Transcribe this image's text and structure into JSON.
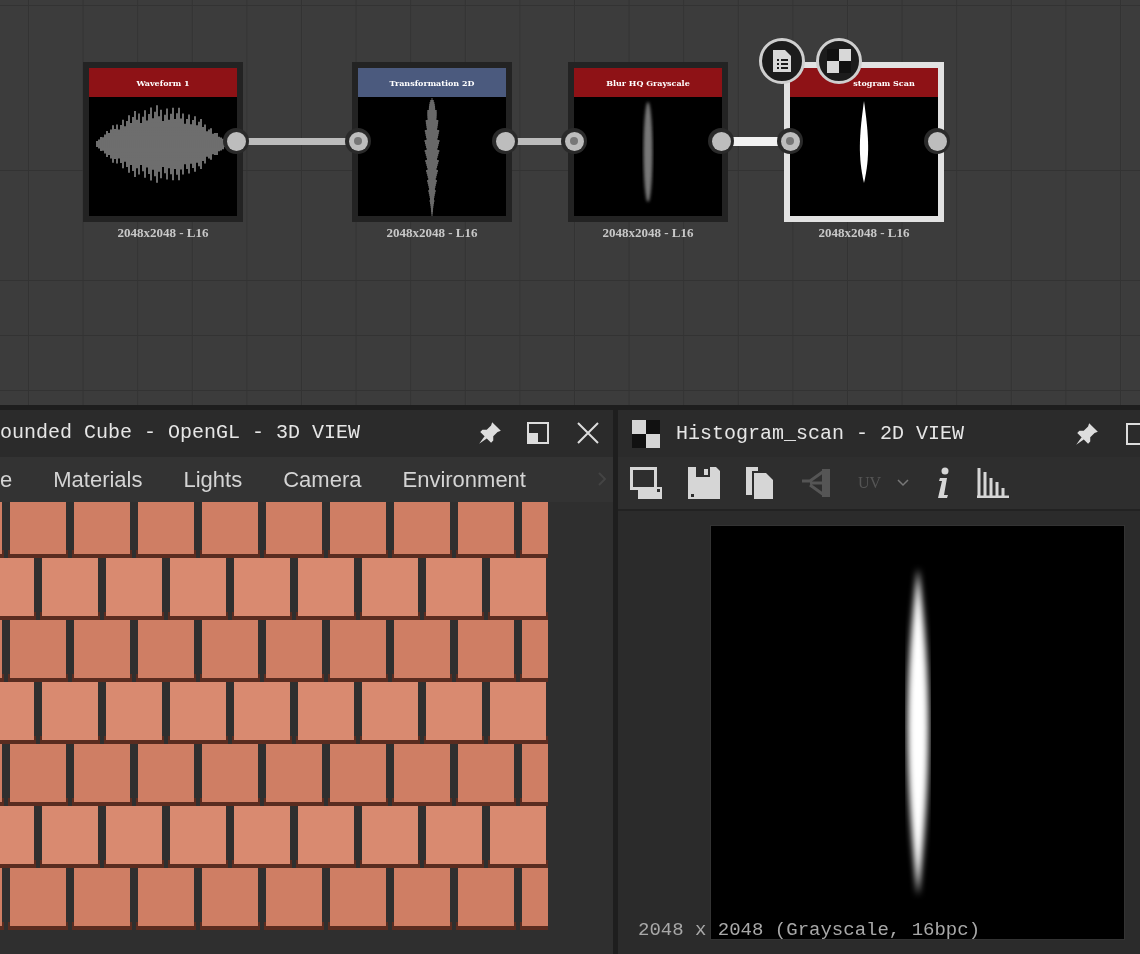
{
  "graph": {
    "nodes": [
      {
        "title": "Waveform 1",
        "color": "#8e1216",
        "kind": "waveform",
        "input": false,
        "selected": false,
        "footer": "2048x2048 - L16"
      },
      {
        "title": "Transformation 2D",
        "color": "#4b5a7e",
        "kind": "thin-waveform",
        "input": true,
        "selected": false,
        "footer": "2048x2048 - L16"
      },
      {
        "title": "Blur HQ Grayscale",
        "color": "#8e1216",
        "kind": "blur",
        "input": true,
        "selected": false,
        "footer": "2048x2048 - L16"
      },
      {
        "title": "stogram Scan",
        "color": "#8e1216",
        "kind": "spindle",
        "input": true,
        "selected": true,
        "footer": "2048x2048 - L16"
      }
    ],
    "links": [
      {
        "selected": false
      },
      {
        "selected": false
      },
      {
        "selected": true
      }
    ]
  },
  "view_3d": {
    "title": "ounded Cube - OpenGL - 3D VIEW",
    "tabs": [
      "e",
      "Materials",
      "Lights",
      "Camera",
      "Environment"
    ]
  },
  "view_2d": {
    "title": "Histogram_scan - 2D VIEW",
    "toolbar": {
      "share_disabled": true,
      "uv": {
        "label": "UV",
        "disabled": true
      }
    },
    "status": "2048 x 2048 (Grayscale, 16bpc)"
  }
}
